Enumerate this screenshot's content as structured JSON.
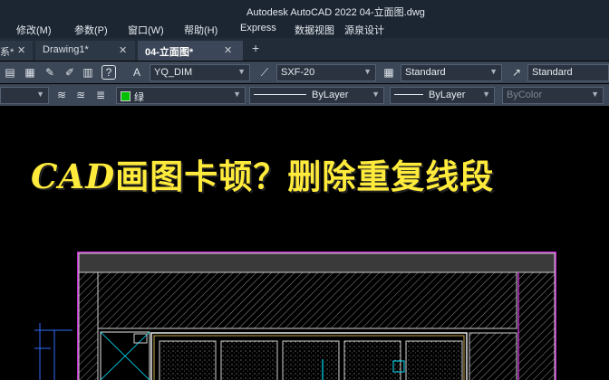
{
  "window": {
    "title": "Autodesk AutoCAD 2022    04-立面图.dwg"
  },
  "menu": [
    {
      "label": "修改(M)"
    },
    {
      "label": "参数(P)"
    },
    {
      "label": "窗口(W)"
    },
    {
      "label": "帮助(H)"
    },
    {
      "label": "Express"
    },
    {
      "label": "数据视图"
    },
    {
      "label": "源泉设计"
    }
  ],
  "tabs": [
    {
      "label": "系*",
      "close": "✕"
    },
    {
      "label": "Drawing1*",
      "close": "✕"
    },
    {
      "label": "04-立面图*",
      "close": "✕"
    }
  ],
  "tab_add": "+",
  "toolbar1": {
    "help_icon": "?",
    "dimstyle": "YQ_DIM",
    "multileader_style": "SXF-20",
    "table_style": "Standard",
    "multileader_standard": "Standard"
  },
  "toolbar2": {
    "color": "绿",
    "linetype": "ByLayer",
    "lineweight": "ByLayer",
    "plotstyle": "ByColor"
  },
  "canvas": {
    "headline_prefix": "CAD",
    "headline_rest": "画图卡顿？删除重复线段"
  },
  "colors": {
    "headline": "#ffeb3b",
    "elevation_frame": "#c02cc8",
    "dim_lines": "#2f6bff",
    "hatch": "#d0d0d0",
    "accent_cyan": "#00e5ff"
  }
}
